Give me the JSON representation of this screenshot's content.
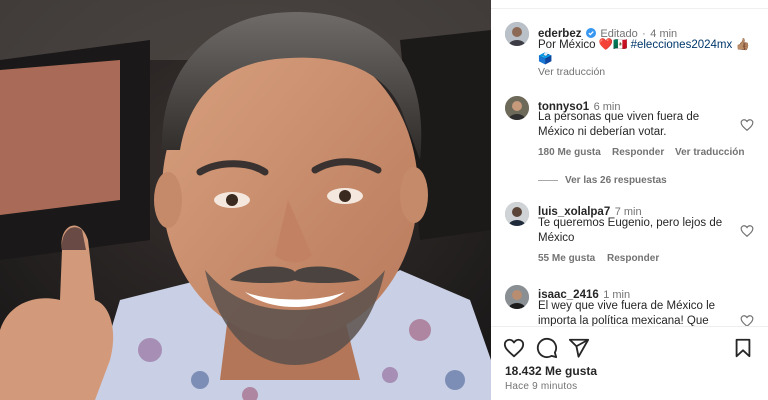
{
  "post": {
    "author": "ederbez",
    "edited_label": "Editado",
    "separator": "·",
    "time": "4 min",
    "caption_text": "Por México",
    "caption_emojis": "❤️🇲🇽",
    "hashtag": "#elecciones2024mx",
    "trailing_emoji": "👍🏽",
    "second_line_emoji": "🗳️",
    "translate": "Ver traducción"
  },
  "comments": [
    {
      "user": "tonnyso1",
      "time": "6 min",
      "text_line1": "La personas que viven fuera de",
      "text_line2": "México ni deberían votar.",
      "likes": "180 Me gusta",
      "reply": "Responder",
      "translate": "Ver traducción",
      "replies_toggle": "Ver las 26 respuestas"
    },
    {
      "user": "luis_xolalpa7",
      "time": "7 min",
      "text_line1": "Te queremos Eugenio, pero lejos de",
      "text_line2": "México",
      "likes": "55 Me gusta",
      "reply": "Responder"
    },
    {
      "user": "isaac_2416",
      "time": "1 min",
      "text_line1": "El wey que vive fuera de México le",
      "text_line2": "importa la política mexicana! Que"
    }
  ],
  "footer": {
    "likes": "18.432 Me gusta",
    "ago": "Hace 9 minutos"
  },
  "icons": {
    "like": "heart-icon",
    "comment": "comment-icon",
    "share": "share-icon",
    "save": "bookmark-icon",
    "verified": "verified-badge-icon"
  },
  "colors": {
    "verified": "#3897f0",
    "hashtag": "#00376b",
    "secondary_text": "#737373",
    "primary_text": "#262626"
  }
}
